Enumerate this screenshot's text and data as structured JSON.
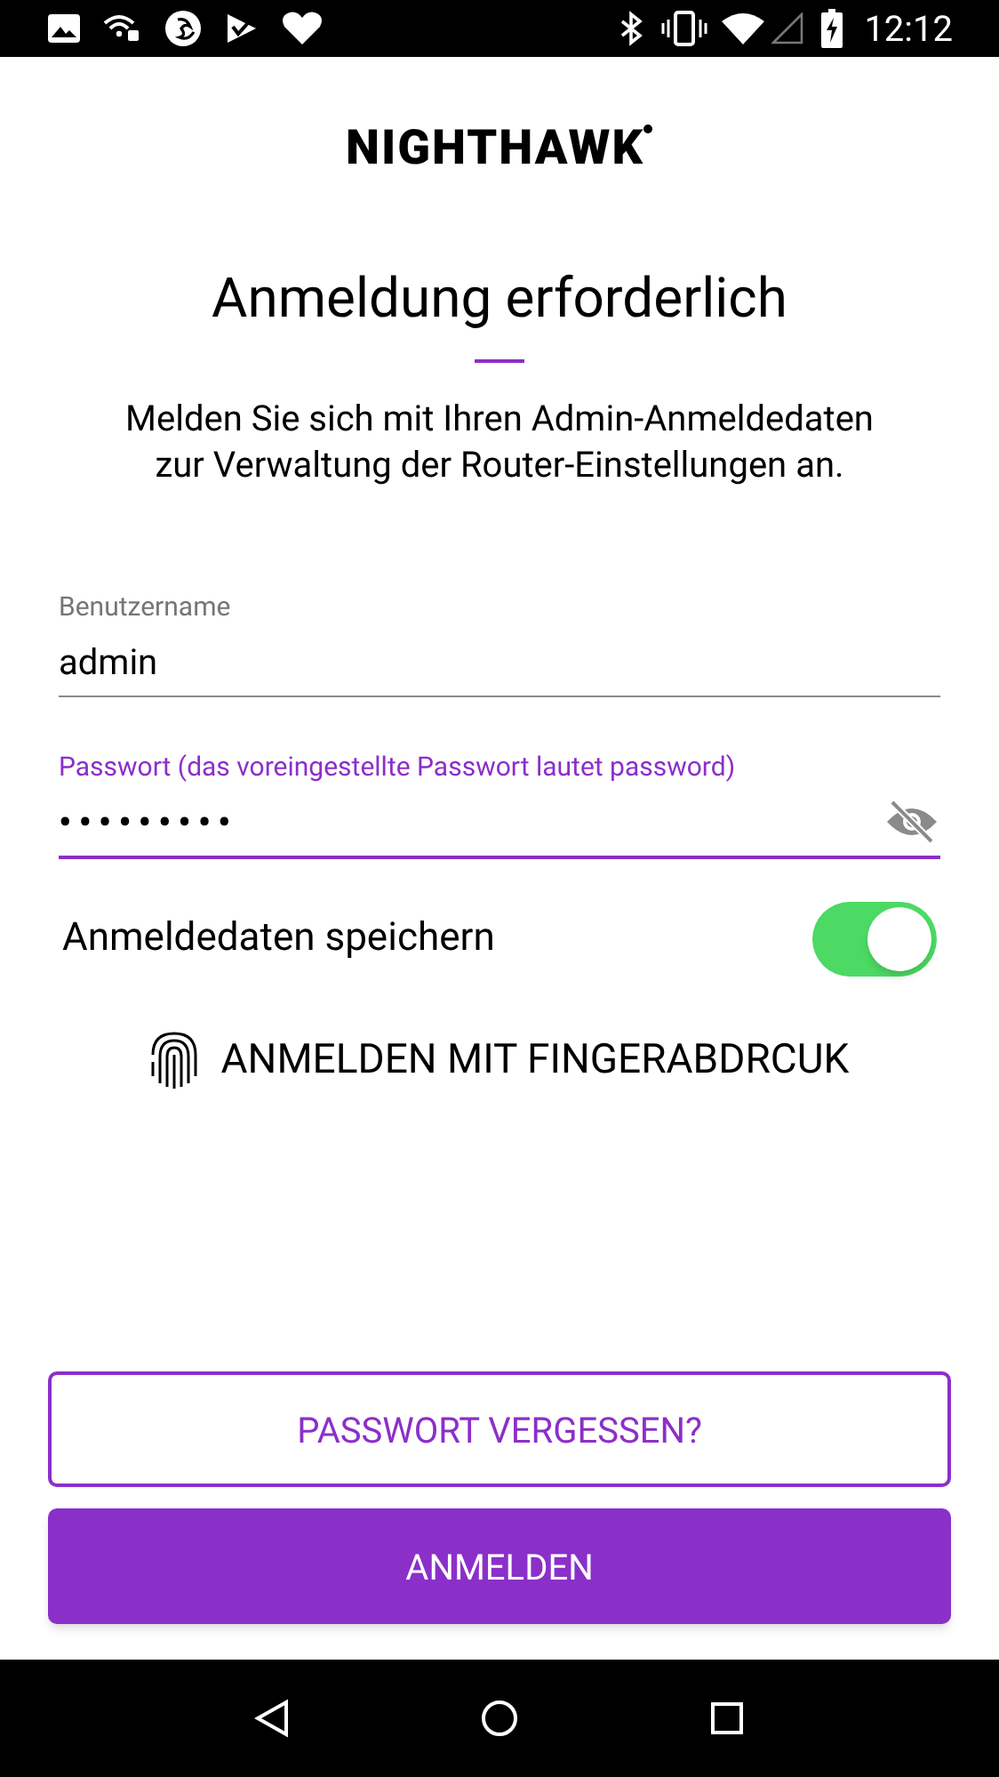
{
  "status_bar": {
    "time": "12:12"
  },
  "logo": {
    "text": "NIGHTHAWK"
  },
  "title": "Anmeldung erforderlich",
  "description": "Melden Sie sich mit Ihren Admin-Anmeldedaten zur Verwaltung der Router-Einstellungen an.",
  "fields": [
    {
      "kind": "text",
      "label": "Benutzername",
      "value": "admin",
      "focused": false
    },
    {
      "kind": "password",
      "label": "Passwort (das voreingestellte Passwort lautet password)",
      "value": "•••••••••",
      "focused": true
    }
  ],
  "remember": {
    "label": "Anmeldedaten speichern",
    "on": true
  },
  "fingerprint_link": "ANMELDEN MIT FINGERABDRCUK",
  "buttons": [
    {
      "kind": "outline",
      "label": "PASSWORT VERGESSEN?"
    },
    {
      "kind": "filled",
      "label": "ANMELDEN"
    }
  ]
}
